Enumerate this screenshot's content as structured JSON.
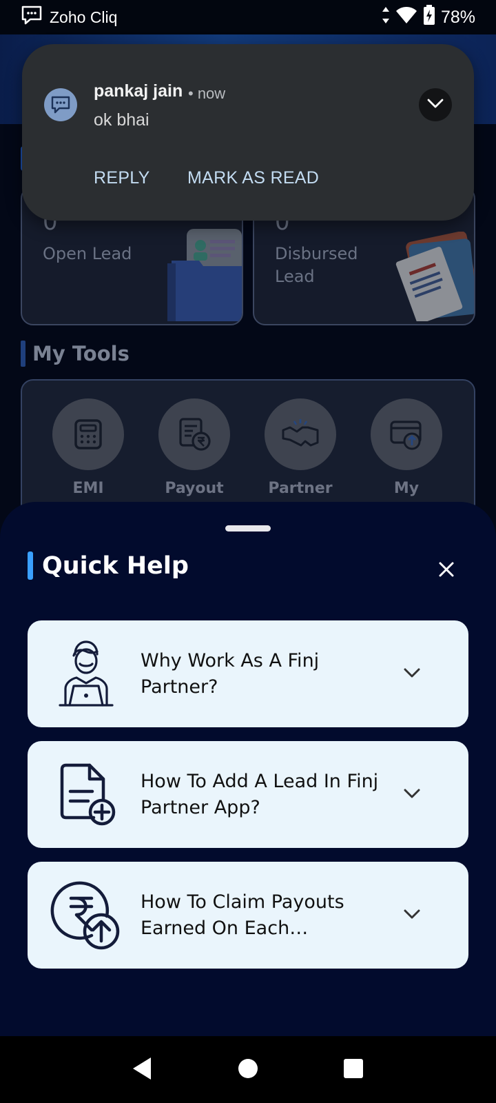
{
  "status_bar": {
    "app_name": "Zoho Cliq",
    "battery": "78%",
    "icons": [
      "chat-notification-icon",
      "data-arrows-icon",
      "wifi-icon",
      "battery-charging-icon"
    ]
  },
  "background_app": {
    "stats": [
      {
        "count": "0",
        "label": "Open Lead"
      },
      {
        "count": "0",
        "label": "Disbursed Lead"
      }
    ],
    "tools_title": "My Tools",
    "tools": [
      {
        "label": "EMI",
        "icon": "calculator-icon"
      },
      {
        "label": "Payout",
        "icon": "rupee-document-icon"
      },
      {
        "label": "Partner",
        "icon": "handshake-icon"
      },
      {
        "label": "My",
        "icon": "card-upload-icon"
      }
    ]
  },
  "notification": {
    "sender": "pankaj jain",
    "time": "• now",
    "message": "ok bhai",
    "actions": {
      "reply": "REPLY",
      "mark_read": "MARK AS READ"
    }
  },
  "quick_help": {
    "title": "Quick Help",
    "accent_color": "#3aa0ff",
    "items": [
      {
        "text": "Why Work As A Finj Partner?",
        "icon": "person-laptop-icon"
      },
      {
        "text": "How To Add A Lead In Finj Partner App?",
        "icon": "document-add-icon"
      },
      {
        "text": "How To Claim Payouts Earned On Each Disbursement",
        "icon": "rupee-upload-icon"
      }
    ]
  },
  "nav_bar": {
    "buttons": [
      "back-icon",
      "home-icon",
      "recents-icon"
    ]
  }
}
